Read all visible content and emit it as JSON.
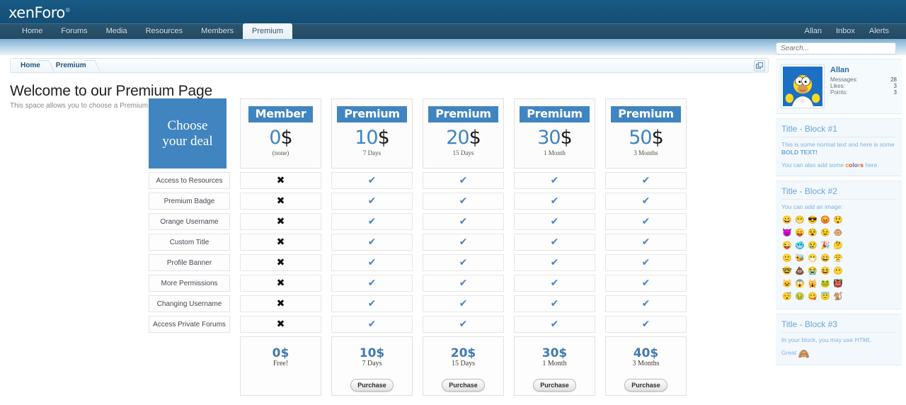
{
  "site": {
    "logo": "xenForo",
    "logo_tm": "®"
  },
  "nav": {
    "items": [
      {
        "label": "Home",
        "active": false
      },
      {
        "label": "Forums",
        "active": false
      },
      {
        "label": "Media",
        "active": false
      },
      {
        "label": "Resources",
        "active": false
      },
      {
        "label": "Members",
        "active": false
      },
      {
        "label": "Premium",
        "active": true
      }
    ],
    "right": [
      {
        "label": "Allan"
      },
      {
        "label": "Inbox"
      },
      {
        "label": "Alerts"
      }
    ]
  },
  "breadcrumb": {
    "items": [
      "Home",
      "Premium"
    ],
    "tool_icon": "open-in-new-window-icon"
  },
  "page": {
    "title": "Welcome to our Premium Page",
    "subtitle": "This space allows you to choose a Premium deal"
  },
  "pricing": {
    "choose_line1": "Choose",
    "choose_line2": "your deal",
    "mark_yes": "✔",
    "mark_no": "✖",
    "purchase_label": "Purchase",
    "plans": [
      {
        "tag": "Member",
        "price": "0",
        "currency": "$",
        "period": "(none)",
        "foot_price": "0$",
        "foot_period": "Free!",
        "purchasable": false
      },
      {
        "tag": "Premium",
        "price": "10",
        "currency": "$",
        "period": "7 Days",
        "foot_price": "10$",
        "foot_period": "7 Days",
        "purchasable": true
      },
      {
        "tag": "Premium",
        "price": "20",
        "currency": "$",
        "period": "15 Days",
        "foot_price": "20$",
        "foot_period": "15 Days",
        "purchasable": true
      },
      {
        "tag": "Premium",
        "price": "30",
        "currency": "$",
        "period": "1 Month",
        "foot_price": "30$",
        "foot_period": "1 Month",
        "purchasable": true
      },
      {
        "tag": "Premium",
        "price": "50",
        "currency": "$",
        "period": "3 Months",
        "foot_price": "40$",
        "foot_period": "3 Months",
        "purchasable": true
      }
    ],
    "features": [
      {
        "label": "Access to Resources",
        "values": [
          false,
          true,
          true,
          true,
          true
        ]
      },
      {
        "label": "Premium Badge",
        "values": [
          false,
          true,
          true,
          true,
          true
        ]
      },
      {
        "label": "Orange Username",
        "values": [
          false,
          true,
          true,
          true,
          true
        ]
      },
      {
        "label": "Custom Title",
        "values": [
          false,
          true,
          true,
          true,
          true
        ]
      },
      {
        "label": "Profile Banner",
        "values": [
          false,
          true,
          true,
          true,
          true
        ]
      },
      {
        "label": "More Permissions",
        "values": [
          false,
          true,
          true,
          true,
          true
        ]
      },
      {
        "label": "Changing Username",
        "values": [
          false,
          true,
          true,
          true,
          true
        ]
      },
      {
        "label": "Access Private Forums",
        "values": [
          false,
          true,
          true,
          true,
          true
        ]
      }
    ]
  },
  "sidebar": {
    "search_placeholder": "Search...",
    "user": {
      "name": "Allan",
      "avatar_alt": "homer-simpson-avatar",
      "stats": [
        {
          "label": "Messages:",
          "value": "28"
        },
        {
          "label": "Likes:",
          "value": "3"
        },
        {
          "label": "Points:",
          "value": "3"
        }
      ]
    },
    "blocks": [
      {
        "title": "Title - Block #1",
        "line1_normal": "This is some normal text and here is some ",
        "line1_bold": "BOLD TEXT!",
        "line2_pre": "You can also add some ",
        "line2_colored": "colors",
        "line2_post": " here."
      },
      {
        "title": "Title - Block #2",
        "line1": "You can add an image:",
        "emoji": [
          "😀",
          "😁",
          "😎",
          "😡",
          "😲",
          "😈",
          "😛",
          "😵",
          "😉",
          "🐵",
          "😜",
          "🥶",
          "😢",
          "🎉",
          "🤔",
          "🙂",
          "🐝",
          "😷",
          "😄",
          "😤",
          "🤓",
          "💩",
          "😭",
          "😆",
          "😶",
          "😺",
          "😱",
          "🙀",
          "🐸",
          "👹",
          "😴",
          "🤢",
          "😋",
          "😇",
          "🐒"
        ]
      },
      {
        "title": "Title - Block #3",
        "line1_pre": "In your block, you may use ",
        "line1_em": "HTML",
        "line1_post": ".",
        "line2": "Great",
        "line2_emoji": "🙈"
      }
    ]
  },
  "colors": {
    "brand_blue": "#4084c0",
    "header_dark": "#15527a",
    "nav_dark": "#2b556f",
    "sidebar_text": "#7eb2dd"
  }
}
